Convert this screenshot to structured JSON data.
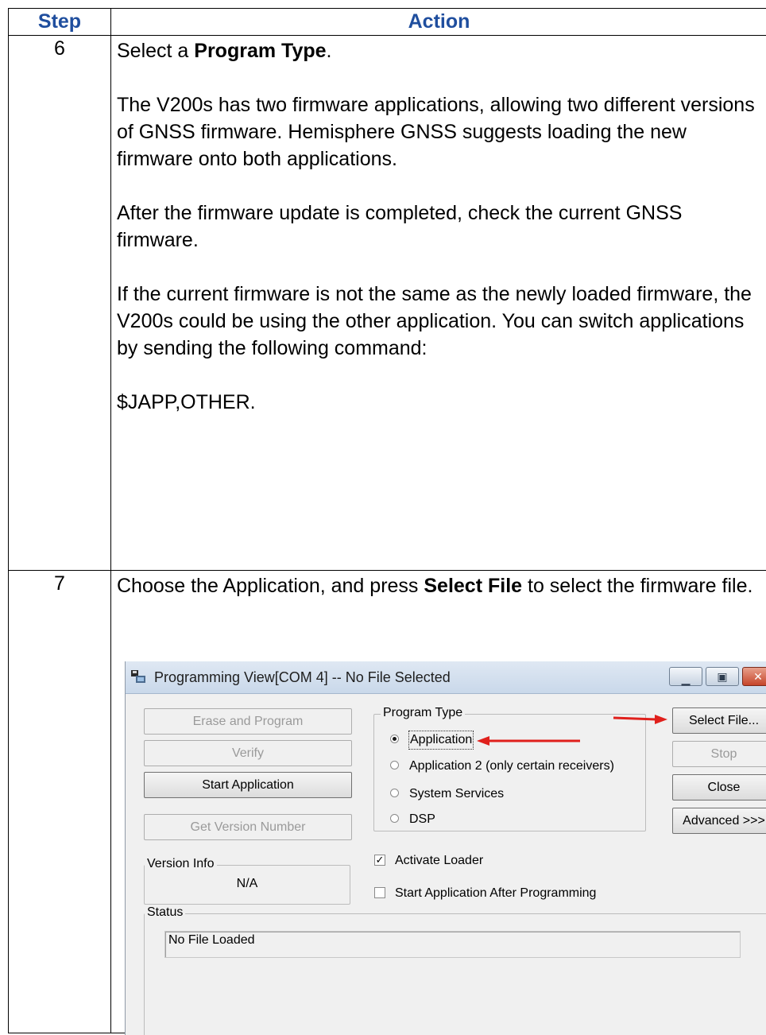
{
  "table": {
    "header_step": "Step",
    "header_action": "Action",
    "rows": [
      {
        "step": "6",
        "p1_pre": "Select a ",
        "p1_bold": "Program Type",
        "p1_post": ".",
        "p2": "The V200s has two firmware applications, allowing two different versions of GNSS firmware. Hemisphere GNSS suggests loading the new firmware onto both applications.",
        "p3": "After the firmware update is completed, check the current GNSS firmware.",
        "p4": "If the current firmware is not the same as the newly loaded firmware, the V200s could be using the other application. You can switch applications by sending the following command:",
        "p5": "$JAPP,OTHER."
      },
      {
        "step": "7",
        "p1_pre": "Choose the Application, and press ",
        "p1_bold": "Select File",
        "p1_post": " to select the firmware file."
      }
    ]
  },
  "dialog": {
    "title": "Programming View[COM 4] -- No File Selected",
    "buttons": {
      "erase_program": "Erase and Program",
      "verify": "Verify",
      "start_application": "Start Application",
      "get_version": "Get Version Number",
      "select_file": "Select File...",
      "stop": "Stop",
      "close": "Close",
      "advanced": "Advanced >>>"
    },
    "program_type": {
      "legend": "Program Type",
      "options": [
        "Application",
        "Application 2 (only certain receivers)",
        "System Services",
        "DSP"
      ],
      "selected": "Application"
    },
    "activate_loader": {
      "label": "Activate Loader",
      "checked": true
    },
    "start_after": {
      "label": "Start Application After Programming",
      "checked": false
    },
    "version_info": {
      "legend": "Version Info",
      "value": "N/A"
    },
    "status": {
      "legend": "Status",
      "value": "No File Loaded"
    },
    "arrow_color": "#e0201c"
  }
}
